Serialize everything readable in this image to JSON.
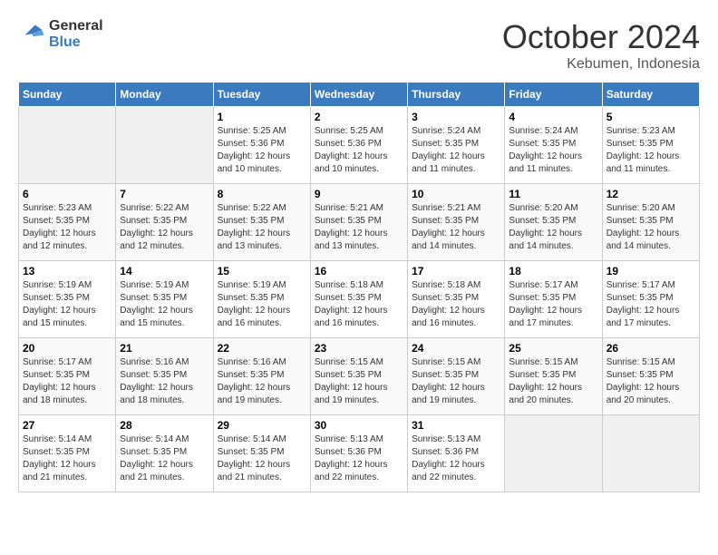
{
  "header": {
    "logo_line1": "General",
    "logo_line2": "Blue",
    "month": "October 2024",
    "location": "Kebumen, Indonesia"
  },
  "weekdays": [
    "Sunday",
    "Monday",
    "Tuesday",
    "Wednesday",
    "Thursday",
    "Friday",
    "Saturday"
  ],
  "weeks": [
    [
      {
        "day": "",
        "sunrise": "",
        "sunset": "",
        "daylight": ""
      },
      {
        "day": "",
        "sunrise": "",
        "sunset": "",
        "daylight": ""
      },
      {
        "day": "1",
        "sunrise": "Sunrise: 5:25 AM",
        "sunset": "Sunset: 5:36 PM",
        "daylight": "Daylight: 12 hours and 10 minutes."
      },
      {
        "day": "2",
        "sunrise": "Sunrise: 5:25 AM",
        "sunset": "Sunset: 5:36 PM",
        "daylight": "Daylight: 12 hours and 10 minutes."
      },
      {
        "day": "3",
        "sunrise": "Sunrise: 5:24 AM",
        "sunset": "Sunset: 5:35 PM",
        "daylight": "Daylight: 12 hours and 11 minutes."
      },
      {
        "day": "4",
        "sunrise": "Sunrise: 5:24 AM",
        "sunset": "Sunset: 5:35 PM",
        "daylight": "Daylight: 12 hours and 11 minutes."
      },
      {
        "day": "5",
        "sunrise": "Sunrise: 5:23 AM",
        "sunset": "Sunset: 5:35 PM",
        "daylight": "Daylight: 12 hours and 11 minutes."
      }
    ],
    [
      {
        "day": "6",
        "sunrise": "Sunrise: 5:23 AM",
        "sunset": "Sunset: 5:35 PM",
        "daylight": "Daylight: 12 hours and 12 minutes."
      },
      {
        "day": "7",
        "sunrise": "Sunrise: 5:22 AM",
        "sunset": "Sunset: 5:35 PM",
        "daylight": "Daylight: 12 hours and 12 minutes."
      },
      {
        "day": "8",
        "sunrise": "Sunrise: 5:22 AM",
        "sunset": "Sunset: 5:35 PM",
        "daylight": "Daylight: 12 hours and 13 minutes."
      },
      {
        "day": "9",
        "sunrise": "Sunrise: 5:21 AM",
        "sunset": "Sunset: 5:35 PM",
        "daylight": "Daylight: 12 hours and 13 minutes."
      },
      {
        "day": "10",
        "sunrise": "Sunrise: 5:21 AM",
        "sunset": "Sunset: 5:35 PM",
        "daylight": "Daylight: 12 hours and 14 minutes."
      },
      {
        "day": "11",
        "sunrise": "Sunrise: 5:20 AM",
        "sunset": "Sunset: 5:35 PM",
        "daylight": "Daylight: 12 hours and 14 minutes."
      },
      {
        "day": "12",
        "sunrise": "Sunrise: 5:20 AM",
        "sunset": "Sunset: 5:35 PM",
        "daylight": "Daylight: 12 hours and 14 minutes."
      }
    ],
    [
      {
        "day": "13",
        "sunrise": "Sunrise: 5:19 AM",
        "sunset": "Sunset: 5:35 PM",
        "daylight": "Daylight: 12 hours and 15 minutes."
      },
      {
        "day": "14",
        "sunrise": "Sunrise: 5:19 AM",
        "sunset": "Sunset: 5:35 PM",
        "daylight": "Daylight: 12 hours and 15 minutes."
      },
      {
        "day": "15",
        "sunrise": "Sunrise: 5:19 AM",
        "sunset": "Sunset: 5:35 PM",
        "daylight": "Daylight: 12 hours and 16 minutes."
      },
      {
        "day": "16",
        "sunrise": "Sunrise: 5:18 AM",
        "sunset": "Sunset: 5:35 PM",
        "daylight": "Daylight: 12 hours and 16 minutes."
      },
      {
        "day": "17",
        "sunrise": "Sunrise: 5:18 AM",
        "sunset": "Sunset: 5:35 PM",
        "daylight": "Daylight: 12 hours and 16 minutes."
      },
      {
        "day": "18",
        "sunrise": "Sunrise: 5:17 AM",
        "sunset": "Sunset: 5:35 PM",
        "daylight": "Daylight: 12 hours and 17 minutes."
      },
      {
        "day": "19",
        "sunrise": "Sunrise: 5:17 AM",
        "sunset": "Sunset: 5:35 PM",
        "daylight": "Daylight: 12 hours and 17 minutes."
      }
    ],
    [
      {
        "day": "20",
        "sunrise": "Sunrise: 5:17 AM",
        "sunset": "Sunset: 5:35 PM",
        "daylight": "Daylight: 12 hours and 18 minutes."
      },
      {
        "day": "21",
        "sunrise": "Sunrise: 5:16 AM",
        "sunset": "Sunset: 5:35 PM",
        "daylight": "Daylight: 12 hours and 18 minutes."
      },
      {
        "day": "22",
        "sunrise": "Sunrise: 5:16 AM",
        "sunset": "Sunset: 5:35 PM",
        "daylight": "Daylight: 12 hours and 19 minutes."
      },
      {
        "day": "23",
        "sunrise": "Sunrise: 5:15 AM",
        "sunset": "Sunset: 5:35 PM",
        "daylight": "Daylight: 12 hours and 19 minutes."
      },
      {
        "day": "24",
        "sunrise": "Sunrise: 5:15 AM",
        "sunset": "Sunset: 5:35 PM",
        "daylight": "Daylight: 12 hours and 19 minutes."
      },
      {
        "day": "25",
        "sunrise": "Sunrise: 5:15 AM",
        "sunset": "Sunset: 5:35 PM",
        "daylight": "Daylight: 12 hours and 20 minutes."
      },
      {
        "day": "26",
        "sunrise": "Sunrise: 5:15 AM",
        "sunset": "Sunset: 5:35 PM",
        "daylight": "Daylight: 12 hours and 20 minutes."
      }
    ],
    [
      {
        "day": "27",
        "sunrise": "Sunrise: 5:14 AM",
        "sunset": "Sunset: 5:35 PM",
        "daylight": "Daylight: 12 hours and 21 minutes."
      },
      {
        "day": "28",
        "sunrise": "Sunrise: 5:14 AM",
        "sunset": "Sunset: 5:35 PM",
        "daylight": "Daylight: 12 hours and 21 minutes."
      },
      {
        "day": "29",
        "sunrise": "Sunrise: 5:14 AM",
        "sunset": "Sunset: 5:35 PM",
        "daylight": "Daylight: 12 hours and 21 minutes."
      },
      {
        "day": "30",
        "sunrise": "Sunrise: 5:13 AM",
        "sunset": "Sunset: 5:36 PM",
        "daylight": "Daylight: 12 hours and 22 minutes."
      },
      {
        "day": "31",
        "sunrise": "Sunrise: 5:13 AM",
        "sunset": "Sunset: 5:36 PM",
        "daylight": "Daylight: 12 hours and 22 minutes."
      },
      {
        "day": "",
        "sunrise": "",
        "sunset": "",
        "daylight": ""
      },
      {
        "day": "",
        "sunrise": "",
        "sunset": "",
        "daylight": ""
      }
    ]
  ]
}
